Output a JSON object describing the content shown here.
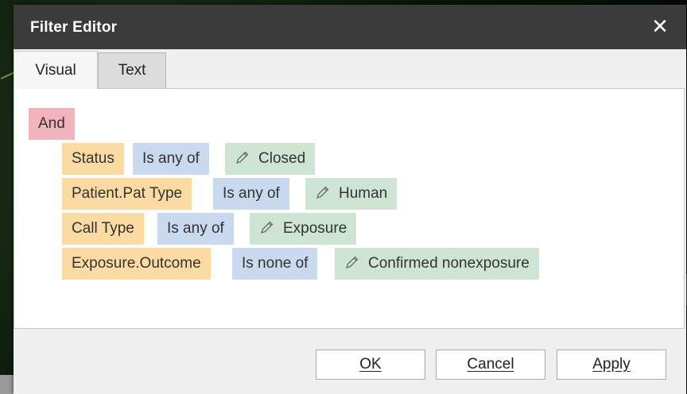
{
  "dialog": {
    "title": "Filter Editor",
    "close_glyph": "✕"
  },
  "tabs": [
    {
      "label": "Visual",
      "active": true
    },
    {
      "label": "Text",
      "active": false
    }
  ],
  "filter": {
    "group_operator": "And",
    "conditions": [
      {
        "field": "Status",
        "operator": "Is any of",
        "value": "Closed"
      },
      {
        "field": "Patient.Pat Type",
        "operator": "Is any of",
        "value": "Human"
      },
      {
        "field": "Call Type",
        "operator": "Is any of",
        "value": "Exposure"
      },
      {
        "field": "Exposure.Outcome",
        "operator": "Is none of",
        "value": "Confirmed nonexposure"
      }
    ]
  },
  "buttons": {
    "ok": "OK",
    "cancel": "Cancel",
    "apply": "Apply"
  },
  "colors": {
    "group": "#f1b4bc",
    "field": "#fbdba2",
    "operator": "#c9d9ee",
    "value": "#cfe5d3",
    "titlebar": "#3b3b3b"
  },
  "icons": {
    "value_edit": "pencil-icon",
    "close": "close-icon"
  }
}
